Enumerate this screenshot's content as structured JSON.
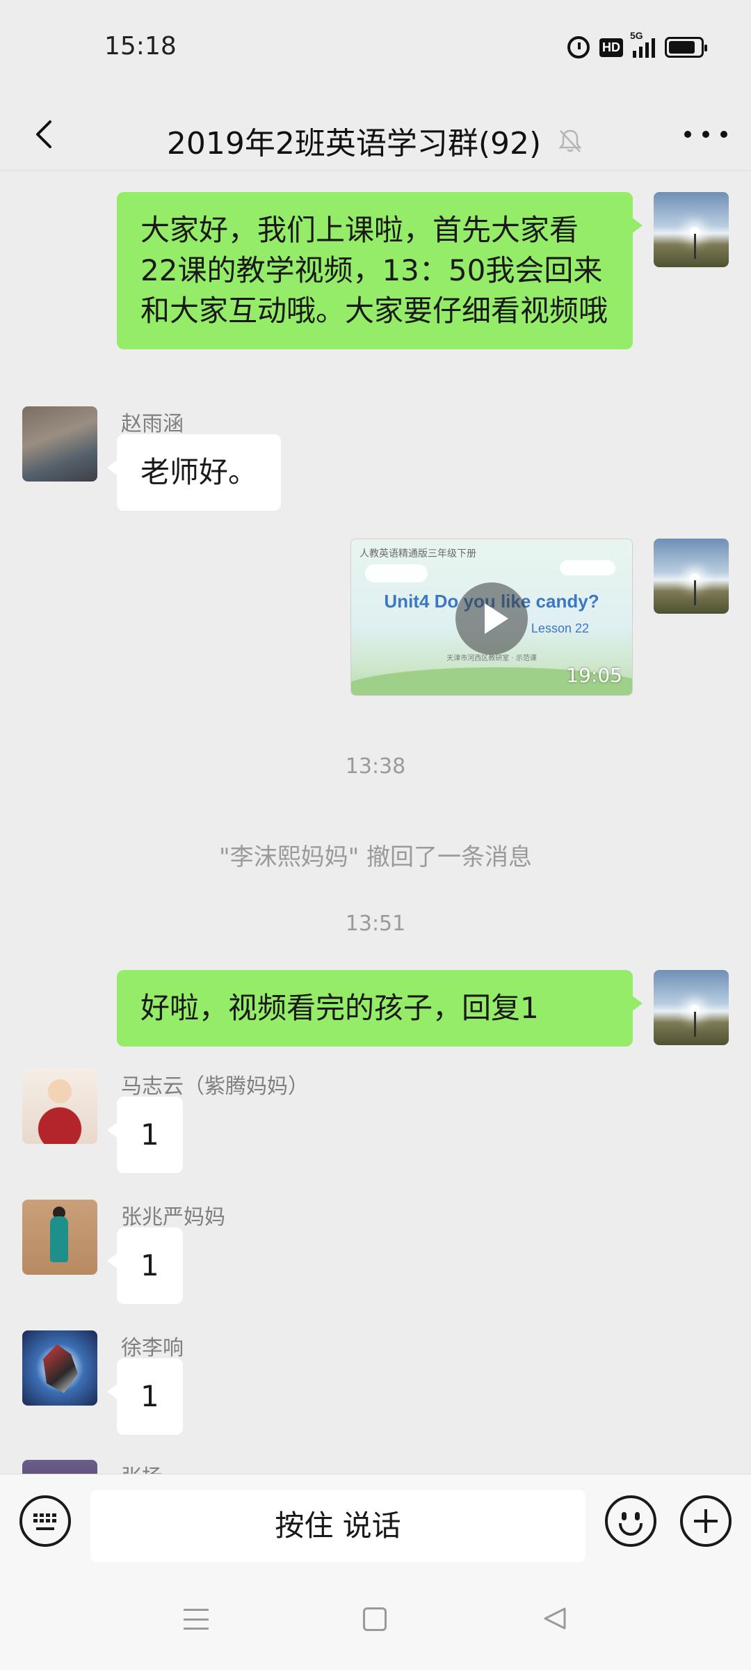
{
  "status_bar": {
    "time": "15:18",
    "hd_label": "HD",
    "network_label": "5G",
    "icons": [
      "alarm-icon",
      "hd-icon",
      "signal-5g-icon",
      "battery-icon"
    ]
  },
  "header": {
    "title": "2019年2班英语学习群(92)",
    "icons": [
      "back-icon",
      "mute-bell-icon",
      "more-icon"
    ]
  },
  "messages": [
    {
      "side": "right",
      "type": "text",
      "text": "大家好，我们上课啦，首先大家看22课的教学视频，13：50我会回来和大家互动哦。大家要仔细看视频哦"
    },
    {
      "side": "left",
      "type": "text",
      "sender": "赵雨涵",
      "text": "老师好。"
    },
    {
      "side": "right",
      "type": "video",
      "video": {
        "top_line": "人教英语精通版三年级下册",
        "title": "Unit4 Do you like candy?",
        "lesson": "Lesson 22",
        "caption": "天津市河西区教研室 · 示范课",
        "duration": "19:05"
      }
    },
    {
      "type": "time",
      "text": "13:38"
    },
    {
      "type": "system",
      "text": "\"李沫熙妈妈\" 撤回了一条消息"
    },
    {
      "type": "time",
      "text": "13:51"
    },
    {
      "side": "right",
      "type": "text",
      "text": "好啦，视频看完的孩子，回复1"
    },
    {
      "side": "left",
      "type": "text",
      "sender": "马志云（紫腾妈妈）",
      "text": "1"
    },
    {
      "side": "left",
      "type": "text",
      "sender": "张兆严妈妈",
      "text": "1"
    },
    {
      "side": "left",
      "type": "text",
      "sender": "徐李响",
      "text": "1"
    },
    {
      "side": "left",
      "type": "partial",
      "sender": "张扬"
    }
  ],
  "input_bar": {
    "voice_label": "按住 说话",
    "icons": [
      "keyboard-icon",
      "emoji-icon",
      "plus-icon"
    ]
  },
  "system_nav": {
    "icons": [
      "menu-icon",
      "home-icon",
      "back-triangle-icon"
    ]
  },
  "colors": {
    "background": "#ededed",
    "self_bubble": "#95ec69",
    "other_bubble": "#ffffff",
    "meta_text": "#9a9a9a"
  }
}
